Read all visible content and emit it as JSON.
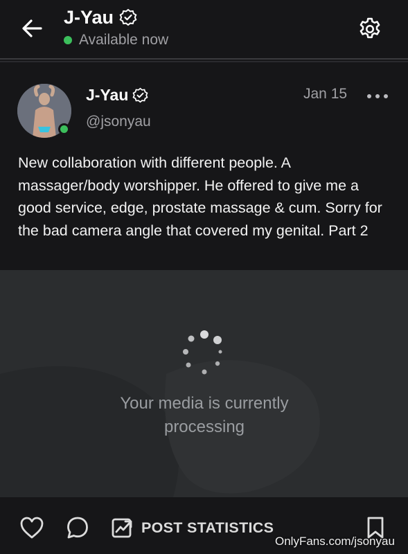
{
  "header": {
    "title": "J-Yau",
    "status": "Available now",
    "back_icon": "arrow-left-icon",
    "settings_icon": "gear-icon"
  },
  "post": {
    "author_name": "J-Yau",
    "handle": "@jsonyau",
    "date": "Jan 15",
    "text": "New collaboration with different people. A massager/body worshipper. He offered to give me a good service, edge, prostate massage & cum. Sorry for the bad camera angle that covered my genital. Part 2",
    "media_status": "Your media is currently processing"
  },
  "actions": {
    "stats_label": "POST STATISTICS"
  },
  "watermark": "OnlyFans.com/jsonyau",
  "colors": {
    "background": "#161618",
    "online": "#3cbf5c",
    "muted_text": "#a0a0a4",
    "media_bg": "#2b2d2f"
  }
}
